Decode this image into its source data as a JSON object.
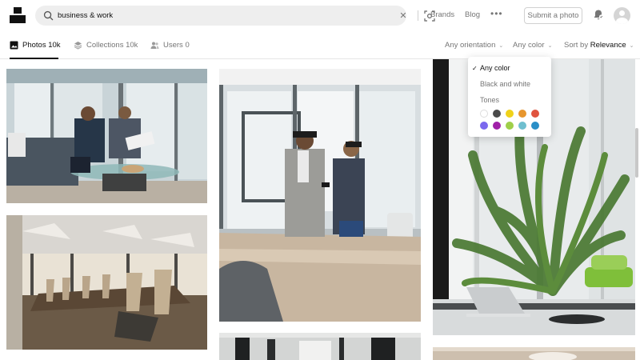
{
  "header": {
    "search_value": "business & work",
    "nav": [
      "Brands",
      "Blog"
    ],
    "more_label": "•••",
    "submit_label": "Submit a photo"
  },
  "tabs": [
    {
      "label": "Photos 10k",
      "icon": "photo-icon",
      "active": true
    },
    {
      "label": "Collections 10k",
      "icon": "collections-icon",
      "active": false
    },
    {
      "label": "Users 0",
      "icon": "users-icon",
      "active": false
    }
  ],
  "filters": {
    "orientation": "Any orientation",
    "color": "Any color",
    "sort_prefix": "Sort by",
    "sort_value": "Relevance"
  },
  "color_menu": {
    "items": [
      "Any color",
      "Black and white",
      "Tones"
    ],
    "selected": "Any color",
    "swatches": [
      "#ffffff",
      "#4a4a4a",
      "#f0d21a",
      "#e7962e",
      "#e0543f",
      "#7b68ee",
      "#a020a8",
      "#9fcf4a",
      "#6fbfcf",
      "#2a8fc7"
    ]
  },
  "photos": [
    {
      "name": "business meeting on sofa"
    },
    {
      "name": "two men in office with phone"
    },
    {
      "name": "office with plant"
    },
    {
      "name": "empty conference room"
    },
    {
      "name": "office hallway"
    },
    {
      "name": "office desk"
    }
  ],
  "colors": {
    "accent": "#111111",
    "muted": "#767676",
    "search_bg": "#eeeeee"
  }
}
